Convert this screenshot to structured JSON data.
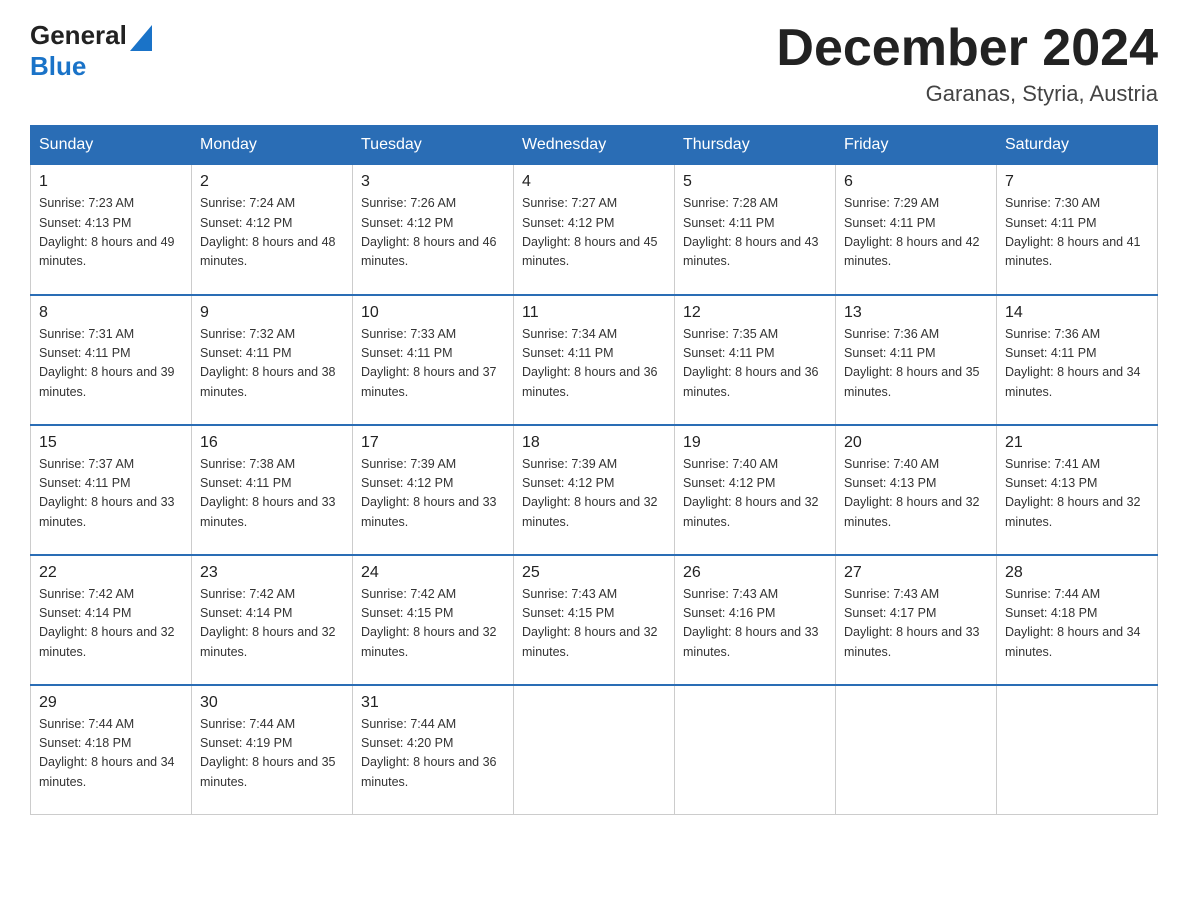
{
  "logo": {
    "general": "General",
    "blue": "Blue",
    "triangle": "▶"
  },
  "title": "December 2024",
  "location": "Garanas, Styria, Austria",
  "days_of_week": [
    "Sunday",
    "Monday",
    "Tuesday",
    "Wednesday",
    "Thursday",
    "Friday",
    "Saturday"
  ],
  "weeks": [
    [
      {
        "day": "1",
        "sunrise": "Sunrise: 7:23 AM",
        "sunset": "Sunset: 4:13 PM",
        "daylight": "Daylight: 8 hours and 49 minutes."
      },
      {
        "day": "2",
        "sunrise": "Sunrise: 7:24 AM",
        "sunset": "Sunset: 4:12 PM",
        "daylight": "Daylight: 8 hours and 48 minutes."
      },
      {
        "day": "3",
        "sunrise": "Sunrise: 7:26 AM",
        "sunset": "Sunset: 4:12 PM",
        "daylight": "Daylight: 8 hours and 46 minutes."
      },
      {
        "day": "4",
        "sunrise": "Sunrise: 7:27 AM",
        "sunset": "Sunset: 4:12 PM",
        "daylight": "Daylight: 8 hours and 45 minutes."
      },
      {
        "day": "5",
        "sunrise": "Sunrise: 7:28 AM",
        "sunset": "Sunset: 4:11 PM",
        "daylight": "Daylight: 8 hours and 43 minutes."
      },
      {
        "day": "6",
        "sunrise": "Sunrise: 7:29 AM",
        "sunset": "Sunset: 4:11 PM",
        "daylight": "Daylight: 8 hours and 42 minutes."
      },
      {
        "day": "7",
        "sunrise": "Sunrise: 7:30 AM",
        "sunset": "Sunset: 4:11 PM",
        "daylight": "Daylight: 8 hours and 41 minutes."
      }
    ],
    [
      {
        "day": "8",
        "sunrise": "Sunrise: 7:31 AM",
        "sunset": "Sunset: 4:11 PM",
        "daylight": "Daylight: 8 hours and 39 minutes."
      },
      {
        "day": "9",
        "sunrise": "Sunrise: 7:32 AM",
        "sunset": "Sunset: 4:11 PM",
        "daylight": "Daylight: 8 hours and 38 minutes."
      },
      {
        "day": "10",
        "sunrise": "Sunrise: 7:33 AM",
        "sunset": "Sunset: 4:11 PM",
        "daylight": "Daylight: 8 hours and 37 minutes."
      },
      {
        "day": "11",
        "sunrise": "Sunrise: 7:34 AM",
        "sunset": "Sunset: 4:11 PM",
        "daylight": "Daylight: 8 hours and 36 minutes."
      },
      {
        "day": "12",
        "sunrise": "Sunrise: 7:35 AM",
        "sunset": "Sunset: 4:11 PM",
        "daylight": "Daylight: 8 hours and 36 minutes."
      },
      {
        "day": "13",
        "sunrise": "Sunrise: 7:36 AM",
        "sunset": "Sunset: 4:11 PM",
        "daylight": "Daylight: 8 hours and 35 minutes."
      },
      {
        "day": "14",
        "sunrise": "Sunrise: 7:36 AM",
        "sunset": "Sunset: 4:11 PM",
        "daylight": "Daylight: 8 hours and 34 minutes."
      }
    ],
    [
      {
        "day": "15",
        "sunrise": "Sunrise: 7:37 AM",
        "sunset": "Sunset: 4:11 PM",
        "daylight": "Daylight: 8 hours and 33 minutes."
      },
      {
        "day": "16",
        "sunrise": "Sunrise: 7:38 AM",
        "sunset": "Sunset: 4:11 PM",
        "daylight": "Daylight: 8 hours and 33 minutes."
      },
      {
        "day": "17",
        "sunrise": "Sunrise: 7:39 AM",
        "sunset": "Sunset: 4:12 PM",
        "daylight": "Daylight: 8 hours and 33 minutes."
      },
      {
        "day": "18",
        "sunrise": "Sunrise: 7:39 AM",
        "sunset": "Sunset: 4:12 PM",
        "daylight": "Daylight: 8 hours and 32 minutes."
      },
      {
        "day": "19",
        "sunrise": "Sunrise: 7:40 AM",
        "sunset": "Sunset: 4:12 PM",
        "daylight": "Daylight: 8 hours and 32 minutes."
      },
      {
        "day": "20",
        "sunrise": "Sunrise: 7:40 AM",
        "sunset": "Sunset: 4:13 PM",
        "daylight": "Daylight: 8 hours and 32 minutes."
      },
      {
        "day": "21",
        "sunrise": "Sunrise: 7:41 AM",
        "sunset": "Sunset: 4:13 PM",
        "daylight": "Daylight: 8 hours and 32 minutes."
      }
    ],
    [
      {
        "day": "22",
        "sunrise": "Sunrise: 7:42 AM",
        "sunset": "Sunset: 4:14 PM",
        "daylight": "Daylight: 8 hours and 32 minutes."
      },
      {
        "day": "23",
        "sunrise": "Sunrise: 7:42 AM",
        "sunset": "Sunset: 4:14 PM",
        "daylight": "Daylight: 8 hours and 32 minutes."
      },
      {
        "day": "24",
        "sunrise": "Sunrise: 7:42 AM",
        "sunset": "Sunset: 4:15 PM",
        "daylight": "Daylight: 8 hours and 32 minutes."
      },
      {
        "day": "25",
        "sunrise": "Sunrise: 7:43 AM",
        "sunset": "Sunset: 4:15 PM",
        "daylight": "Daylight: 8 hours and 32 minutes."
      },
      {
        "day": "26",
        "sunrise": "Sunrise: 7:43 AM",
        "sunset": "Sunset: 4:16 PM",
        "daylight": "Daylight: 8 hours and 33 minutes."
      },
      {
        "day": "27",
        "sunrise": "Sunrise: 7:43 AM",
        "sunset": "Sunset: 4:17 PM",
        "daylight": "Daylight: 8 hours and 33 minutes."
      },
      {
        "day": "28",
        "sunrise": "Sunrise: 7:44 AM",
        "sunset": "Sunset: 4:18 PM",
        "daylight": "Daylight: 8 hours and 34 minutes."
      }
    ],
    [
      {
        "day": "29",
        "sunrise": "Sunrise: 7:44 AM",
        "sunset": "Sunset: 4:18 PM",
        "daylight": "Daylight: 8 hours and 34 minutes."
      },
      {
        "day": "30",
        "sunrise": "Sunrise: 7:44 AM",
        "sunset": "Sunset: 4:19 PM",
        "daylight": "Daylight: 8 hours and 35 minutes."
      },
      {
        "day": "31",
        "sunrise": "Sunrise: 7:44 AM",
        "sunset": "Sunset: 4:20 PM",
        "daylight": "Daylight: 8 hours and 36 minutes."
      },
      null,
      null,
      null,
      null
    ]
  ]
}
